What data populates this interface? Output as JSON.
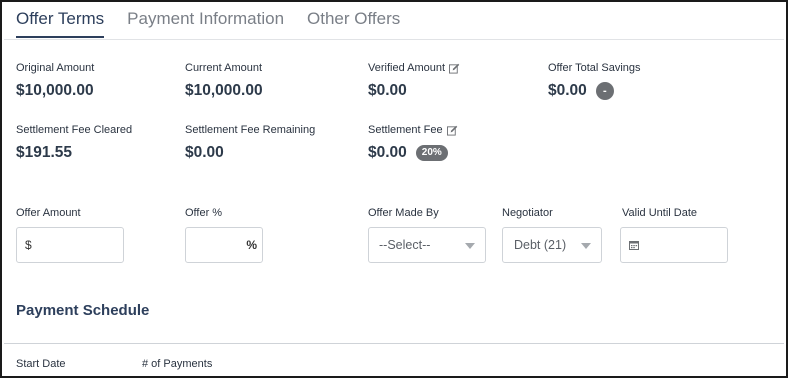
{
  "tabs": [
    {
      "label": "Offer Terms",
      "active": true
    },
    {
      "label": "Payment Information",
      "active": false
    },
    {
      "label": "Other Offers",
      "active": false
    }
  ],
  "summary": {
    "original_amount": {
      "label": "Original Amount",
      "value": "$10,000.00"
    },
    "current_amount": {
      "label": "Current Amount",
      "value": "$10,000.00"
    },
    "verified_amount": {
      "label": "Verified Amount",
      "value": "$0.00",
      "icon": "edit-icon"
    },
    "offer_total_savings": {
      "label": "Offer Total Savings",
      "value": "$0.00",
      "badge": "-"
    },
    "settlement_fee_cleared": {
      "label": "Settlement Fee Cleared",
      "value": "$191.55"
    },
    "settlement_fee_remaining": {
      "label": "Settlement Fee Remaining",
      "value": "$0.00"
    },
    "settlement_fee": {
      "label": "Settlement Fee",
      "value": "$0.00",
      "badge": "20%",
      "icon": "edit-icon"
    }
  },
  "form": {
    "offer_amount": {
      "label": "Offer Amount",
      "prefix": "$",
      "value": ""
    },
    "offer_percent": {
      "label": "Offer %",
      "suffix": "%",
      "value": ""
    },
    "offer_made_by": {
      "label": "Offer Made By",
      "selected": "--Select--"
    },
    "negotiator": {
      "label": "Negotiator",
      "selected": "Debt (21)"
    },
    "valid_until_date": {
      "label": "Valid Until Date",
      "value": "",
      "icon": "calendar-icon"
    }
  },
  "payment_schedule": {
    "title": "Payment Schedule",
    "columns": [
      "Start Date",
      "# of Payments"
    ]
  },
  "colors": {
    "accent": "#2d3f5c",
    "badge": "#6c6f73",
    "border": "#cfd3d8"
  }
}
